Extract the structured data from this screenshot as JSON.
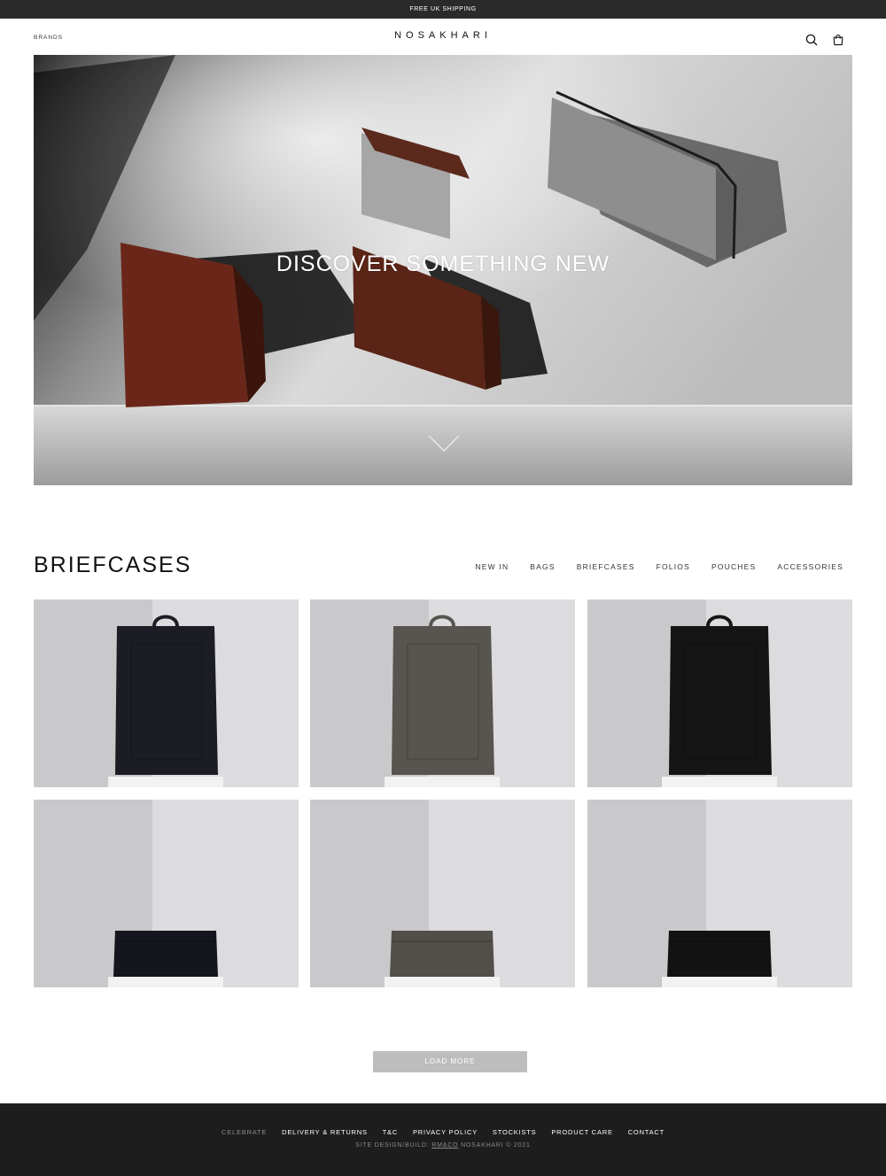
{
  "promo": {
    "text": "FREE UK SHIPPING"
  },
  "header": {
    "brands_label": "BRANDS",
    "logo": "NOSAKHARI",
    "search_icon": "search-icon",
    "cart_icon": "shopping-bag-icon"
  },
  "hero": {
    "title": "DISCOVER SOMETHING NEW",
    "scroll_icon": "chevron-down-icon"
  },
  "section": {
    "title": "BRIEFCASES",
    "categories": [
      "NEW IN",
      "BAGS",
      "BRIEFCASES",
      "FOLIOS",
      "POUCHES",
      "ACCESSORIES"
    ]
  },
  "products": [
    {
      "style": "tote",
      "color": "#1b1c24"
    },
    {
      "style": "tote",
      "color": "#585550"
    },
    {
      "style": "tote",
      "color": "#151515"
    },
    {
      "style": "folio",
      "color": "#14151d"
    },
    {
      "style": "folio",
      "color": "#524f4a"
    },
    {
      "style": "folio",
      "color": "#121212"
    }
  ],
  "load_more": {
    "label": "LOAD MORE"
  },
  "footer": {
    "links": [
      "CELEBRATE",
      "DELIVERY & RETURNS",
      "T&C",
      "PRIVACY POLICY",
      "STOCKISTS",
      "PRODUCT CARE",
      "CONTACT"
    ],
    "credit_prefix": "SITE DESIGN/BUILD: ",
    "credit_link": "RM&CO",
    "credit_suffix": " NOSAKHARI © 2021"
  }
}
